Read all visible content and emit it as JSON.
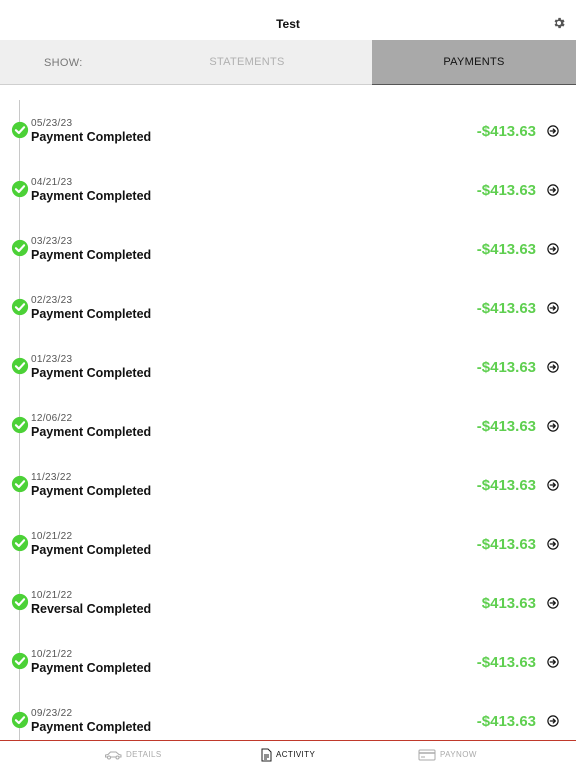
{
  "header": {
    "title": "Test"
  },
  "tabs": {
    "show_label": "SHOW:",
    "statements_label": "STATEMENTS",
    "payments_label": "PAYMENTS",
    "active": "payments"
  },
  "colors": {
    "amount_green": "#5fcf50",
    "check_green": "#4cd137",
    "accent_red": "#c0392b"
  },
  "payments": [
    {
      "date": "05/23/23",
      "status": "Payment Completed",
      "amount": "-$413.63"
    },
    {
      "date": "04/21/23",
      "status": "Payment Completed",
      "amount": "-$413.63"
    },
    {
      "date": "03/23/23",
      "status": "Payment Completed",
      "amount": "-$413.63"
    },
    {
      "date": "02/23/23",
      "status": "Payment Completed",
      "amount": "-$413.63"
    },
    {
      "date": "01/23/23",
      "status": "Payment Completed",
      "amount": "-$413.63"
    },
    {
      "date": "12/06/22",
      "status": "Payment Completed",
      "amount": "-$413.63"
    },
    {
      "date": "11/23/22",
      "status": "Payment Completed",
      "amount": "-$413.63"
    },
    {
      "date": "10/21/22",
      "status": "Payment Completed",
      "amount": "-$413.63"
    },
    {
      "date": "10/21/22",
      "status": "Reversal Completed",
      "amount": "$413.63"
    },
    {
      "date": "10/21/22",
      "status": "Payment Completed",
      "amount": "-$413.63"
    },
    {
      "date": "09/23/22",
      "status": "Payment Completed",
      "amount": "-$413.63"
    }
  ],
  "bottom_nav": {
    "details_label": "DETAILS",
    "activity_label": "ACTIVITY",
    "paynow_label": "PAYNOW",
    "active": "activity"
  }
}
